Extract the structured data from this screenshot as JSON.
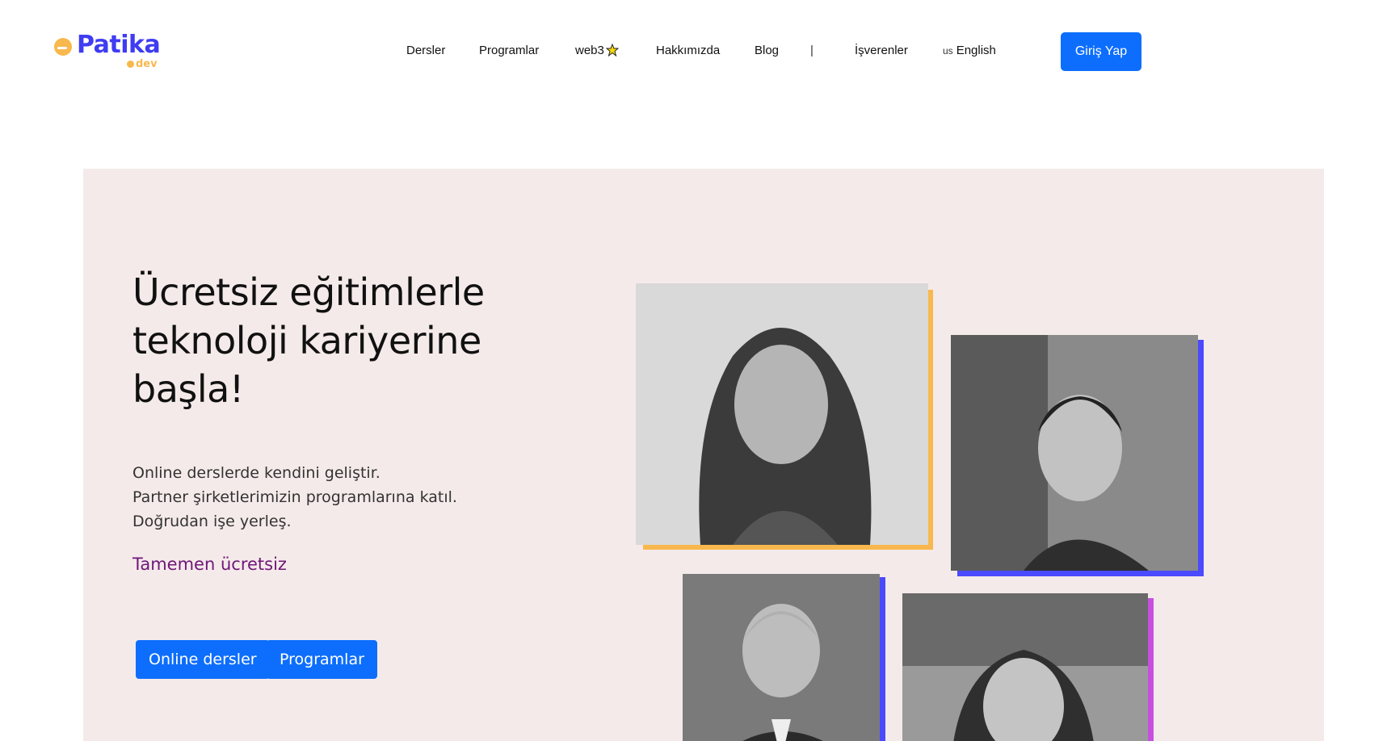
{
  "brand": {
    "logo_text": "Patika",
    "logo_sub": "dev",
    "primary_color": "#3f3cf2",
    "accent_color": "#f8b84e"
  },
  "nav": {
    "items": [
      {
        "label": "Dersler"
      },
      {
        "label": "Programlar"
      },
      {
        "label": "web3",
        "icon": "web3-badge-icon"
      },
      {
        "label": "Hakkımızda"
      },
      {
        "label": "Blog"
      }
    ],
    "separator": "|",
    "employers": "İşverenler",
    "language": {
      "flag_code": "us",
      "label": "English"
    },
    "login_label": "Giriş Yap"
  },
  "hero": {
    "title": "Ücretsiz eğitimlerle teknoloji kariyerine başla!",
    "lines": [
      "Online derslerde kendini geliştir.",
      "Partner şirketlerimizin programlarına katıl.",
      "Doğrudan işe yerleş."
    ],
    "free_text": "Tamemen ücretsiz",
    "buttons": [
      {
        "label": "Online dersler"
      },
      {
        "label": "Programlar"
      }
    ],
    "background_color": "#f5eaea",
    "photo_accents": [
      "#f8b84e",
      "#4a4aff",
      "#4a4aff",
      "#c74fe0"
    ]
  }
}
